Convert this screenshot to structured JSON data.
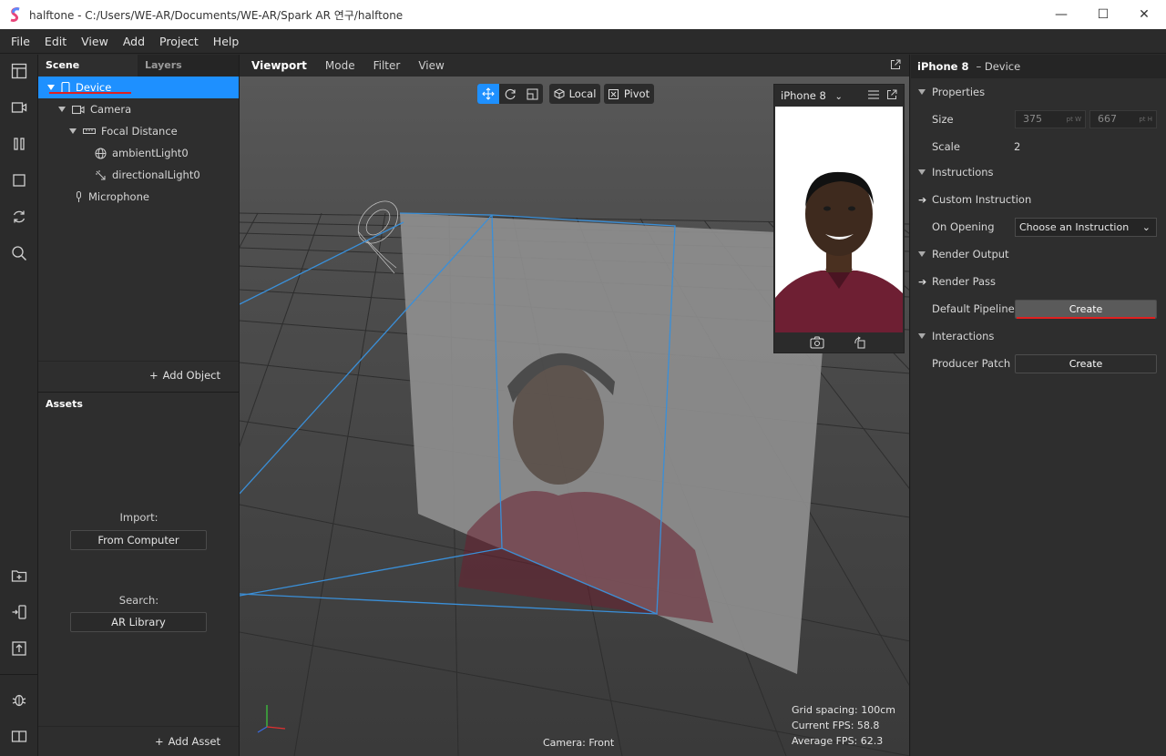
{
  "window": {
    "title": "halftone - C:/Users/WE-AR/Documents/WE-AR/Spark AR 연구/halftone",
    "minimize": "—",
    "maximize": "☐",
    "close": "✕"
  },
  "menu": [
    "File",
    "Edit",
    "View",
    "Add",
    "Project",
    "Help"
  ],
  "scene_panel": {
    "tabs": [
      "Scene",
      "Layers"
    ],
    "tree": [
      {
        "label": "Device",
        "icon": "phone-icon",
        "selected": true
      },
      {
        "label": "Camera",
        "icon": "camera-icon"
      },
      {
        "label": "Focal Distance",
        "icon": "focal-distance-icon"
      },
      {
        "label": "ambientLight0",
        "icon": "globe-icon"
      },
      {
        "label": "directionalLight0",
        "icon": "directional-light-icon"
      },
      {
        "label": "Microphone",
        "icon": "microphone-icon"
      }
    ],
    "add_object": "Add Object"
  },
  "assets_panel": {
    "title": "Assets",
    "import_label": "Import:",
    "from_computer": "From Computer",
    "search_label": "Search:",
    "ar_library": "AR Library",
    "add_asset": "Add Asset"
  },
  "viewport": {
    "tabs": [
      "Viewport",
      "Mode",
      "Filter",
      "View"
    ],
    "toolbar": {
      "local": "Local",
      "pivot": "Pivot"
    },
    "preview": {
      "device": "iPhone 8"
    },
    "camera_label": "Camera: Front",
    "stats": {
      "grid_spacing": "Grid spacing: 100cm",
      "current_fps": "Current FPS:  58.8",
      "average_fps": "Average FPS:  62.3"
    }
  },
  "inspector": {
    "object": "iPhone 8",
    "object_type": "– Device",
    "properties_title": "Properties",
    "size_label": "Size",
    "size_w": "375",
    "size_w_unit": "pt W",
    "size_h": "667",
    "size_h_unit": "pt H",
    "scale_label": "Scale",
    "scale_value": "2",
    "instructions_title": "Instructions",
    "custom_instruction": "Custom Instruction",
    "on_opening_label": "On Opening",
    "on_opening_value": "Choose an Instruction",
    "render_output_title": "Render Output",
    "render_pass": "Render Pass",
    "default_pipeline_label": "Default Pipeline",
    "default_pipeline_button": "Create",
    "interactions_title": "Interactions",
    "producer_patch_label": "Producer Patch",
    "producer_patch_button": "Create"
  },
  "colors": {
    "selection": "#1e90ff",
    "annotation_underline": "#e02020",
    "frustum": "#3a8fd8"
  }
}
